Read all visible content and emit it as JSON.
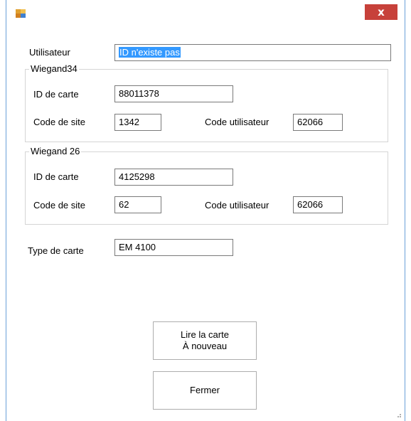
{
  "window": {
    "title": "",
    "close_label": "x"
  },
  "form": {
    "user_label": "Utilisateur",
    "user_value": "ID n'existe pas",
    "wiegand34": {
      "title": "Wiegand34",
      "card_id_label": "ID de carte",
      "card_id_value": "88011378",
      "site_code_label": "Code de site",
      "site_code_value": "1342",
      "user_code_label": "Code utilisateur",
      "user_code_value": "62066"
    },
    "wiegand26": {
      "title": "Wiegand 26",
      "card_id_label": "ID de carte",
      "card_id_value": "4125298",
      "site_code_label": "Code de site",
      "site_code_value": "62",
      "user_code_label": "Code utilisateur",
      "user_code_value": "62066"
    },
    "card_type_label": "Type de carte",
    "card_type_value": "EM 4100"
  },
  "buttons": {
    "read_line1": "Lire la carte",
    "read_line2": "À nouveau",
    "close": "Fermer"
  },
  "colors": {
    "close_button": "#c7413a",
    "selection": "#3399ff",
    "window_border": "#6aa0d8"
  }
}
